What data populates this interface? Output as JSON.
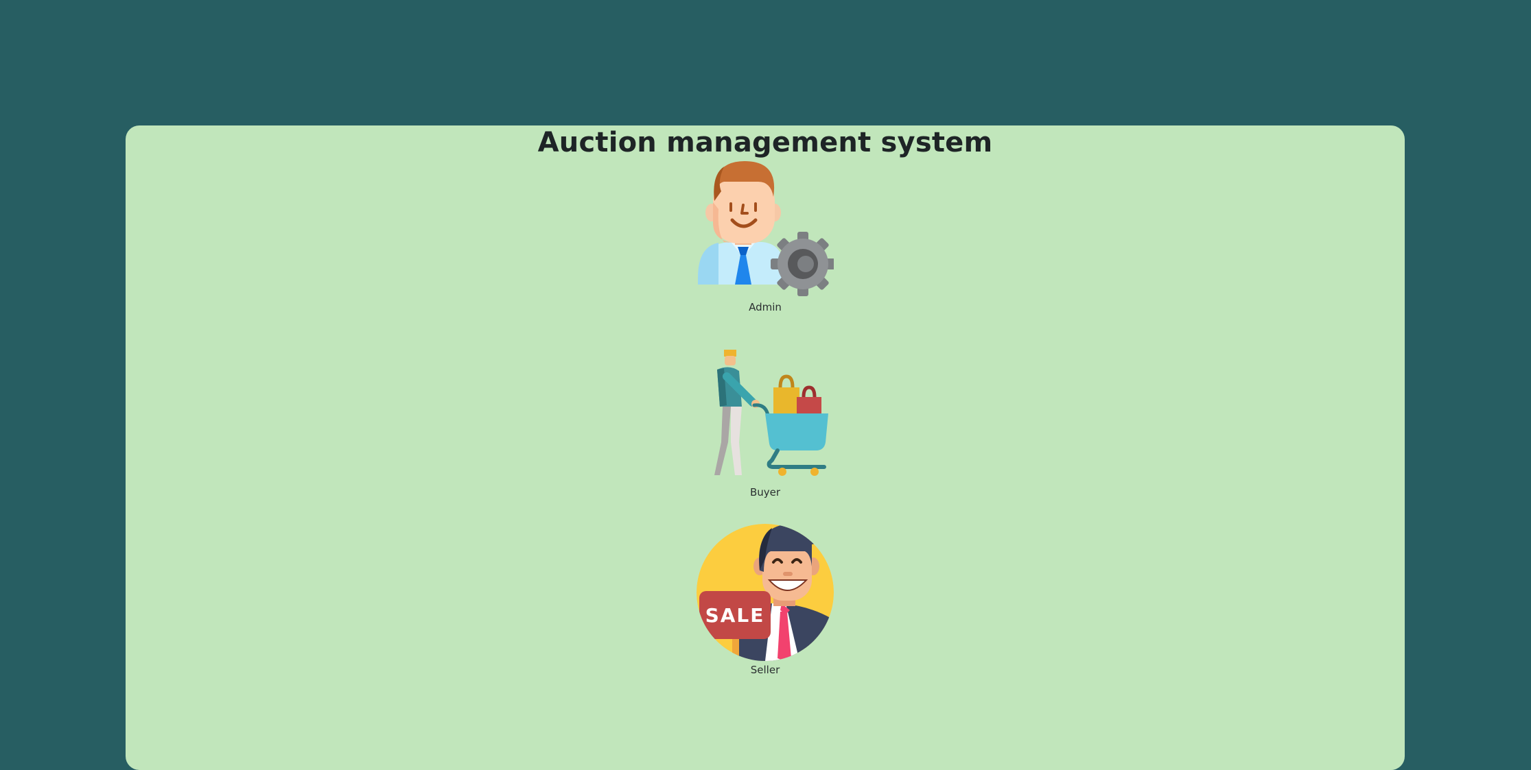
{
  "page": {
    "title": "Auction management system"
  },
  "roles": [
    {
      "label": "Admin",
      "icon": "admin-gear-icon"
    },
    {
      "label": "Buyer",
      "icon": "shopping-cart-icon"
    },
    {
      "label": "Seller",
      "icon": "seller-sale-icon"
    }
  ],
  "seller_sign_text": "SALE",
  "colors": {
    "background": "#275e62",
    "card": "#c1e6bb",
    "title": "#1e2426"
  }
}
